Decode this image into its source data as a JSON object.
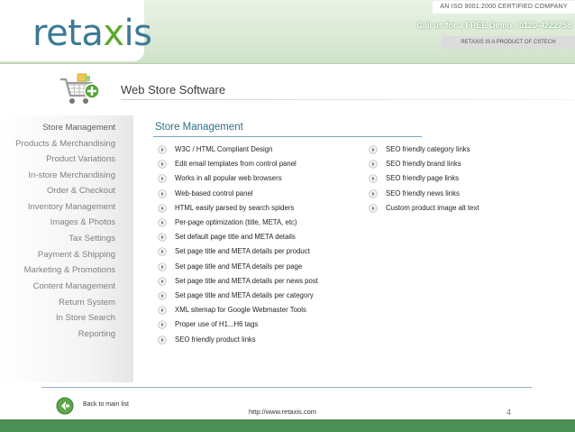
{
  "header": {
    "logo": {
      "main": "reta",
      "x_letter": "x",
      "tail": "is"
    },
    "iso_text": "AN ISO 9001:2000 CERTIFIED COMPANY",
    "call_text": "Call us for a FREE Demo : 0120-4222758",
    "product_text": "RETAXIS IS A PRODUCT OF CSTECH"
  },
  "page": {
    "heading": "Web Store Software",
    "cart_icon": "shopping-cart-add-icon"
  },
  "sidebar": {
    "items": [
      {
        "label": "Store Management",
        "active": true
      },
      {
        "label": "Products & Merchandising"
      },
      {
        "label": "Product Variations"
      },
      {
        "label": "In-store Merchandising"
      },
      {
        "label": "Order & Checkout"
      },
      {
        "label": "Inventory Management"
      },
      {
        "label": "Images & Photos"
      },
      {
        "label": "Tax Settings"
      },
      {
        "label": "Payment & Shipping"
      },
      {
        "label": "Marketing & Promotions"
      },
      {
        "label": "Content Management"
      },
      {
        "label": "Return System"
      },
      {
        "label": "In Store Search"
      },
      {
        "label": "Reporting"
      }
    ]
  },
  "main": {
    "title": "Store Management",
    "features_left": [
      "W3C / HTML Compliant Design",
      "Edit email templates from control panel",
      "Works in all popular web browsers",
      "Web-based control panel",
      "HTML easily parsed by search spiders",
      "Per-page optimization (title, META, etc)",
      "Set default page title and META details",
      "Set page title and META details per product",
      "Set page title and META details per page",
      "Set page title and META details per news post",
      "Set page title and META details per category",
      "XML sitemap for Google Webmaster Tools",
      "Proper use of H1...H6 tags",
      "SEO friendly product links"
    ],
    "features_right": [
      "SEO friendly category links",
      "SEO friendly brand links",
      "SEO friendly page links",
      "SEO friendly news links",
      "Custom product image alt text"
    ]
  },
  "footer": {
    "back_label": "Back to main list",
    "back_icon": "arrow-left-icon",
    "url": "http://www.retaxis.com",
    "page_number": "4"
  },
  "colors": {
    "brand_blue": "#3c7a96",
    "brand_green": "#5aaa2e",
    "title_blue": "#2f6f8a",
    "bottom_bar": "#4c8f55"
  }
}
